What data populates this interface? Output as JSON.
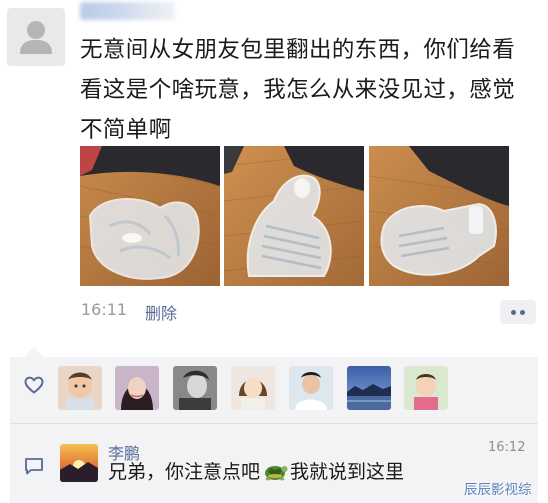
{
  "post": {
    "text": "无意间从女朋友包里翻出的东西，你们给看看这是个啥玩意，我怎么从来没见过，感觉不简单啊",
    "time": "16:11",
    "delete_label": "删除"
  },
  "photos": [
    {
      "icon": "plastic-packaging-photo-1"
    },
    {
      "icon": "plastic-packaging-photo-2"
    },
    {
      "icon": "plastic-packaging-photo-3"
    }
  ],
  "likes": {
    "icon": "heart-icon",
    "avatar_count": 7
  },
  "comment": {
    "icon": "comment-icon",
    "author": "李鹏",
    "time": "16:12",
    "text_before": "兄弟，你注意点吧",
    "emoji": "turtle-emoji",
    "text_after": "我就说到这里"
  },
  "watermark": "辰辰影视综",
  "colors": {
    "link_blue": "#576b95",
    "panel_bg": "#f3f3f5",
    "meta_gray": "#9a9a9a"
  }
}
